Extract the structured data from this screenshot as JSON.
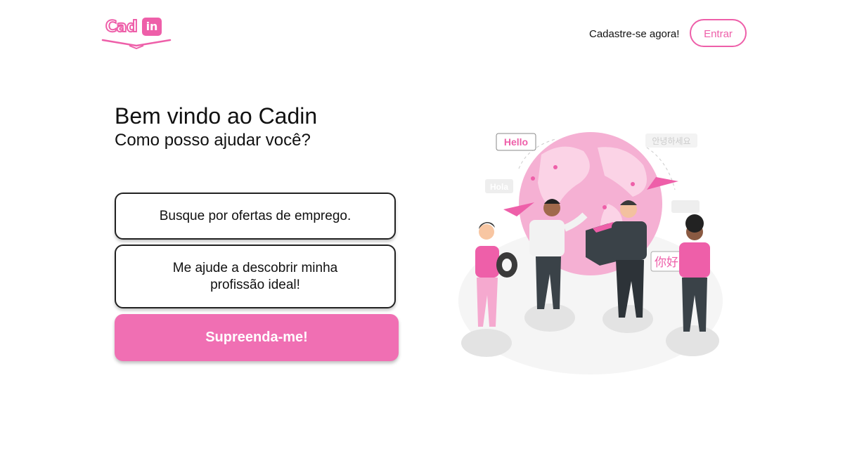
{
  "header": {
    "logo_text": "Cad",
    "logo_badge": "in",
    "signup_label": "Cadastre-se agora!",
    "login_label": "Entrar"
  },
  "hero": {
    "title": "Bem vindo ao Cadin",
    "subtitle": "Como posso ajudar você?"
  },
  "options": [
    {
      "label": "Busque por ofertas de emprego."
    },
    {
      "label": "Me ajude a descobrir minha profissão ideal!"
    }
  ],
  "surprise_label": "Supreenda-me!",
  "illustration": {
    "bubbles": [
      "Hello",
      "Hola",
      "안녕하세요",
      "你好"
    ]
  },
  "colors": {
    "accent": "#ee5fa9",
    "button": "#f06fb3"
  }
}
